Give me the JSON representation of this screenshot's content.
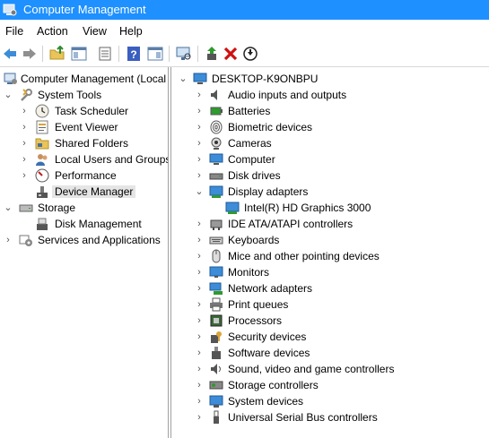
{
  "window": {
    "title": "Computer Management",
    "app_icon": "computer-management-icon"
  },
  "menu": [
    {
      "label": "File",
      "underline": "F"
    },
    {
      "label": "Action",
      "underline": "A"
    },
    {
      "label": "View",
      "underline": "V"
    },
    {
      "label": "Help",
      "underline": "H"
    }
  ],
  "toolbar": [
    "back-arrow-icon",
    "forward-arrow-icon",
    "up-folder-icon",
    "show-hide-tree-icon",
    "properties-icon",
    "help-icon",
    "show-hide-action-pane-icon",
    "scan-hardware-icon",
    "enable-driver-icon",
    "uninstall-device-icon",
    "disable-device-icon"
  ],
  "left_tree": {
    "root": "Computer Management (Local",
    "system_tools": "System Tools",
    "task_scheduler": "Task Scheduler",
    "event_viewer": "Event Viewer",
    "shared_folders": "Shared Folders",
    "local_users": "Local Users and Groups",
    "performance": "Performance",
    "device_manager": "Device Manager",
    "storage": "Storage",
    "disk_management": "Disk Management",
    "services": "Services and Applications"
  },
  "right_tree": {
    "computer_name": "DESKTOP-K9ONBPU",
    "categories": [
      "Audio inputs and outputs",
      "Batteries",
      "Biometric devices",
      "Cameras",
      "Computer",
      "Disk drives",
      "Display adapters",
      "Intel(R) HD Graphics 3000",
      "IDE ATA/ATAPI controllers",
      "Keyboards",
      "Mice and other pointing devices",
      "Monitors",
      "Network adapters",
      "Print queues",
      "Processors",
      "Security devices",
      "Software devices",
      "Sound, video and game controllers",
      "Storage controllers",
      "System devices",
      "Universal Serial Bus controllers"
    ]
  },
  "colors": {
    "titlebar": "#1e90ff",
    "selection": "#e5e5e5",
    "accent": "#3c8cd8"
  }
}
